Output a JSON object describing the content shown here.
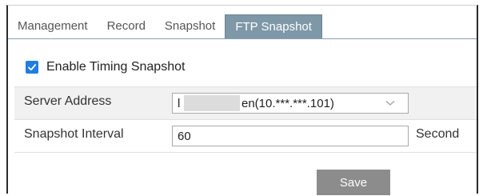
{
  "tabs": [
    {
      "label": "Management",
      "active": false
    },
    {
      "label": "Record",
      "active": false
    },
    {
      "label": "Snapshot",
      "active": false
    },
    {
      "label": "FTP Snapshot",
      "active": true
    }
  ],
  "enable_timing": {
    "label": "Enable Timing Snapshot",
    "checked": true
  },
  "server_address": {
    "label": "Server Address",
    "value": "en(10.***.***.101)"
  },
  "snapshot_interval": {
    "label": "Snapshot Interval",
    "value": "60",
    "unit": "Second"
  },
  "save_label": "Save",
  "colors": {
    "active_tab": "#7e98a8",
    "checkbox": "#1f7ee0",
    "save_button": "#8c8c8c"
  }
}
